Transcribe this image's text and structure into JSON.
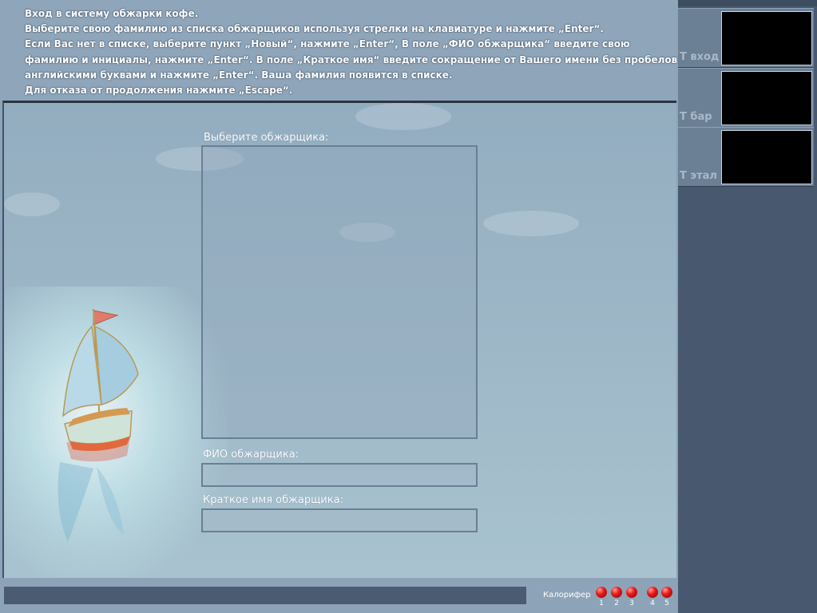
{
  "instructions": {
    "lines": [
      "Вход в систему обжарки кофе.",
      "Выберите свою фамилию из списка обжарщиков используя стрелки на клавиатуре и нажмите „Enter“.",
      "Если Вас нет в списке, выберите пункт „Новый“, нажмите „Enter“, В поле „ФИО обжарщика“ введите свою",
      "фамилию и инициалы, нажмите „Enter“. В поле „Краткое имя“ введите сокращение от Вашего имени без пробелов",
      "английскими буквами и нажмите „Enter“. Ваша фамилия появится в списке.",
      "Для отказа от продолжения нажмите „Escape“."
    ]
  },
  "form": {
    "select_label": "Выберите обжарщика:",
    "fio_label": "ФИО обжарщика:",
    "fio_value": "",
    "short_label": "Краткое имя обжарщика:",
    "short_value": ""
  },
  "sidebar": {
    "tiles": [
      {
        "label": "Т вход"
      },
      {
        "label": "Т бар"
      },
      {
        "label": "Т этал"
      }
    ]
  },
  "status": {
    "heater_label": "Калорифер",
    "leds": [
      "1",
      "2",
      "3",
      "4",
      "5"
    ],
    "led_color": "#e81a1a"
  },
  "colors": {
    "sidebar": "#48596f",
    "background": "#8da4b8"
  }
}
